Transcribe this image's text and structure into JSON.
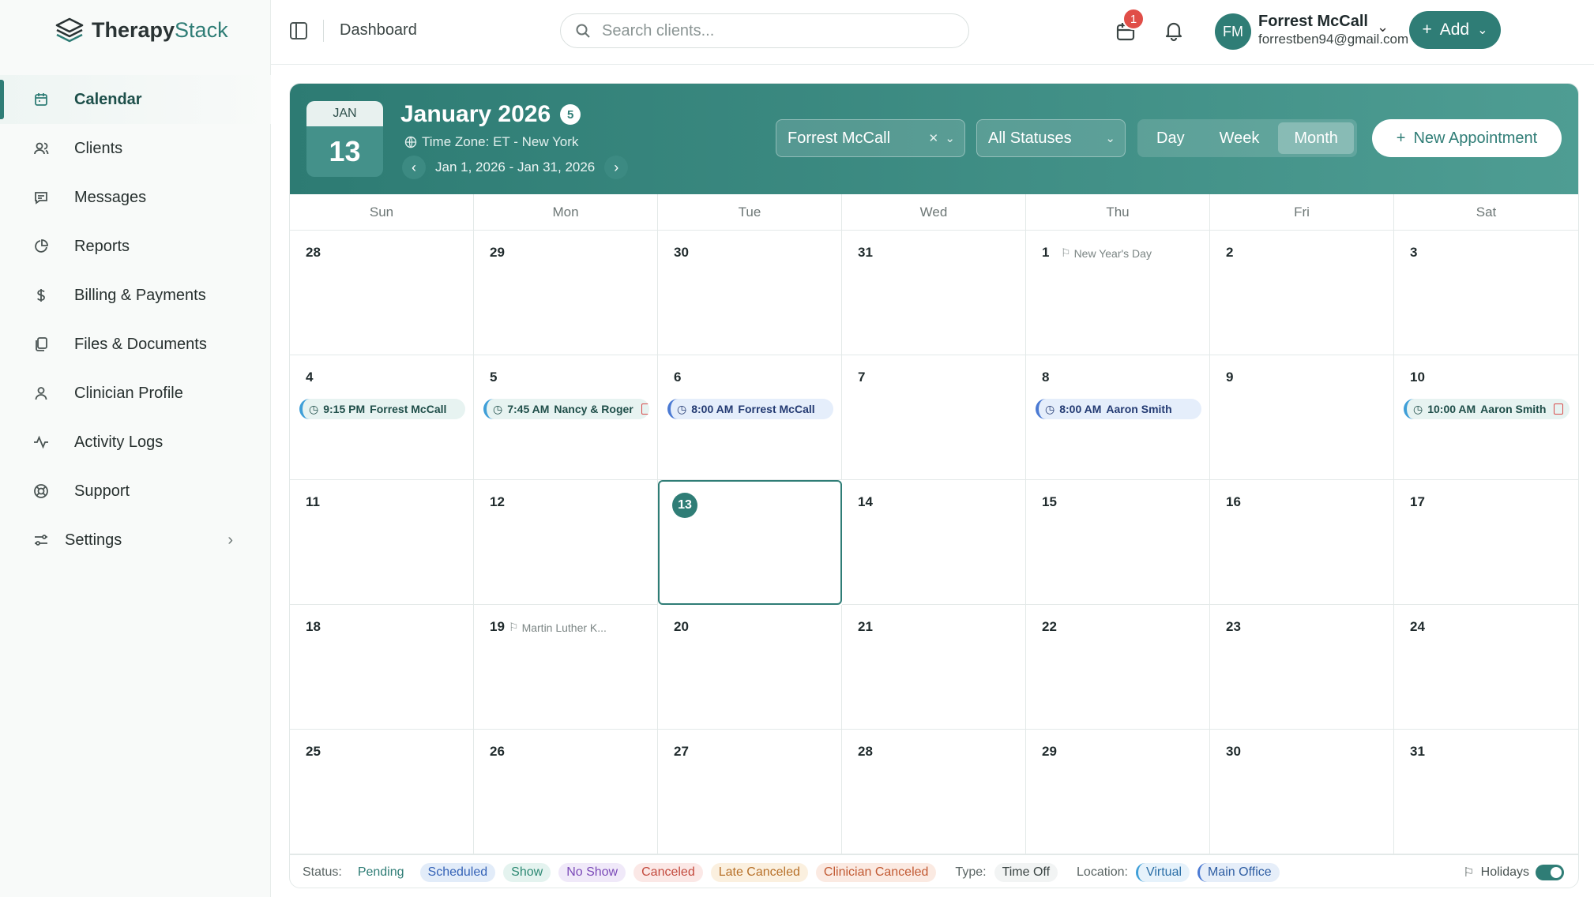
{
  "brand": {
    "name_part1": "Therapy",
    "name_part2": "Stack",
    "accent": "#2f7d76"
  },
  "sidebar": {
    "items": [
      {
        "label": "Calendar",
        "icon": "calendar-icon",
        "active": true
      },
      {
        "label": "Clients",
        "icon": "users-icon"
      },
      {
        "label": "Messages",
        "icon": "message-icon"
      },
      {
        "label": "Reports",
        "icon": "pie-chart-icon"
      },
      {
        "label": "Billing & Payments",
        "icon": "dollar-icon"
      },
      {
        "label": "Files & Documents",
        "icon": "files-icon"
      },
      {
        "label": "Clinician Profile",
        "icon": "user-icon"
      },
      {
        "label": "Activity Logs",
        "icon": "activity-icon"
      },
      {
        "label": "Support",
        "icon": "lifebuoy-icon"
      },
      {
        "label": "Settings",
        "icon": "sliders-icon"
      }
    ]
  },
  "header": {
    "breadcrumb": "Dashboard",
    "search_placeholder": "Search clients...",
    "notification_count": "1",
    "user_initials": "FM",
    "user_name": "Forrest McCall",
    "user_email": "forrestben94@gmail.com",
    "add_label": "Add"
  },
  "calendar": {
    "tile_month": "JAN",
    "tile_day": "13",
    "title": "January 2026",
    "event_count": "5",
    "timezone": "Time Zone: ET - New York",
    "range": "Jan 1, 2026 - Jan 31, 2026",
    "clinician_filter": "Forrest McCall",
    "status_filter": "All Statuses",
    "views": [
      "Day",
      "Week",
      "Month"
    ],
    "selected_view": "Month",
    "new_appointment_label": "New Appointment",
    "weekdays": [
      "Sun",
      "Mon",
      "Tue",
      "Wed",
      "Thu",
      "Fri",
      "Sat"
    ],
    "days": [
      {
        "n": "28"
      },
      {
        "n": "29"
      },
      {
        "n": "30"
      },
      {
        "n": "31"
      },
      {
        "n": "1",
        "holiday": "New Year's Day"
      },
      {
        "n": "2"
      },
      {
        "n": "3"
      },
      {
        "n": "4",
        "appt": {
          "time": "9:15 PM",
          "name": "Forrest McCall",
          "kind": "virtual"
        }
      },
      {
        "n": "5",
        "appt": {
          "time": "7:45 AM",
          "name": "Nancy & Roger",
          "kind": "virtual",
          "doc": true
        }
      },
      {
        "n": "6",
        "appt": {
          "time": "8:00 AM",
          "name": "Forrest McCall",
          "kind": "scheduled"
        }
      },
      {
        "n": "7"
      },
      {
        "n": "8",
        "appt": {
          "time": "8:00 AM",
          "name": "Aaron Smith",
          "kind": "scheduled"
        }
      },
      {
        "n": "9"
      },
      {
        "n": "10",
        "appt": {
          "time": "10:00 AM",
          "name": "Aaron Smith",
          "kind": "virtual",
          "doc": true
        }
      },
      {
        "n": "11"
      },
      {
        "n": "12"
      },
      {
        "n": "13",
        "today": true
      },
      {
        "n": "14"
      },
      {
        "n": "15"
      },
      {
        "n": "16"
      },
      {
        "n": "17"
      },
      {
        "n": "18"
      },
      {
        "n": "19",
        "holiday": "Martin Luther K..."
      },
      {
        "n": "20"
      },
      {
        "n": "21"
      },
      {
        "n": "22"
      },
      {
        "n": "23"
      },
      {
        "n": "24"
      },
      {
        "n": "25"
      },
      {
        "n": "26"
      },
      {
        "n": "27"
      },
      {
        "n": "28"
      },
      {
        "n": "29"
      },
      {
        "n": "30"
      },
      {
        "n": "31"
      }
    ]
  },
  "legend": {
    "status_label": "Status:",
    "statuses": [
      "Pending",
      "Scheduled",
      "Show",
      "No Show",
      "Canceled",
      "Late Canceled",
      "Clinician Canceled"
    ],
    "type_label": "Type:",
    "type_value": "Time Off",
    "location_label": "Location:",
    "locations": [
      "Virtual",
      "Main Office"
    ],
    "holidays_label": "Holidays",
    "holidays_on": true
  }
}
